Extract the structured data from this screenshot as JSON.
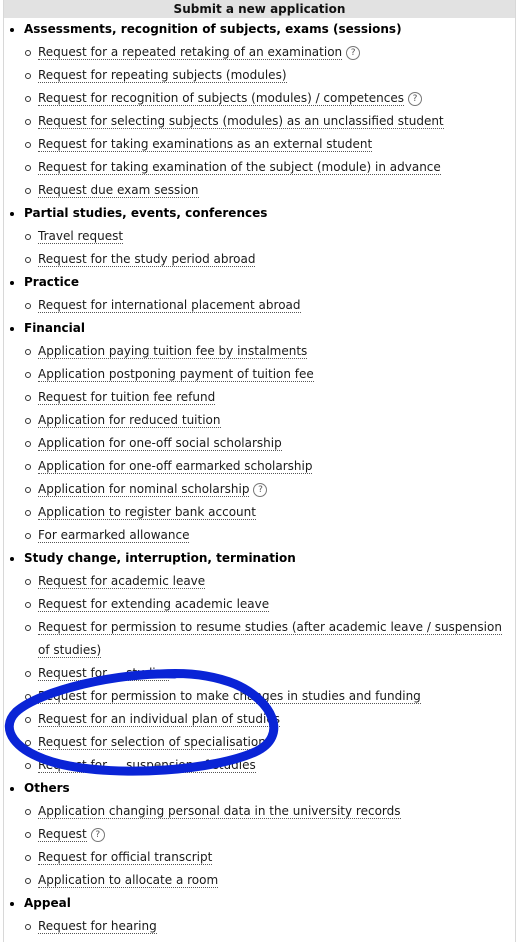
{
  "header": {
    "title": "Submit a new application"
  },
  "groups": [
    {
      "title": "Assessments, recognition of subjects, exams (sessions)",
      "items": [
        {
          "label": "Request for a repeated retaking of an examination",
          "help": true
        },
        {
          "label": "Request for repeating subjects (modules)",
          "help": false
        },
        {
          "label": "Request for recognition of subjects (modules) / competences",
          "help": true
        },
        {
          "label": "Request for selecting subjects (modules) as an unclassified student",
          "help": false
        },
        {
          "label": "Request for taking examinations as an external student",
          "help": false
        },
        {
          "label": "Request for taking examination of the subject (module) in advance",
          "help": false
        },
        {
          "label": "Request due exam session",
          "help": false
        }
      ]
    },
    {
      "title": "Partial studies, events, conferences",
      "items": [
        {
          "label": "Travel request",
          "help": false
        },
        {
          "label": "Request for the study period abroad",
          "help": false
        }
      ]
    },
    {
      "title": "Practice",
      "items": [
        {
          "label": "Request for international placement abroad",
          "help": false
        }
      ]
    },
    {
      "title": "Financial",
      "items": [
        {
          "label": "Application paying tuition fee by instalments",
          "help": false
        },
        {
          "label": "Application postponing payment of tuition fee",
          "help": false
        },
        {
          "label": "Request for tuition fee refund",
          "help": false
        },
        {
          "label": "Application for reduced tuition",
          "help": false
        },
        {
          "label": "Application for one-off social scholarship",
          "help": false
        },
        {
          "label": "Application for one-off earmarked scholarship",
          "help": false
        },
        {
          "label": "Application for nominal scholarship",
          "help": true
        },
        {
          "label": "Application to register bank account",
          "help": false
        },
        {
          "label": "For earmarked allowance",
          "help": false
        }
      ]
    },
    {
      "title": "Study change, interruption, termination",
      "items": [
        {
          "label": "Request for academic leave",
          "help": false
        },
        {
          "label": "Request for extending academic leave",
          "help": false
        },
        {
          "label": "Request for permission to resume studies (after academic leave / suspension of studies)",
          "help": false
        },
        {
          "label": "Request for ... studies",
          "help": false
        },
        {
          "label": "Request for permission to make changes in studies and funding",
          "help": false
        },
        {
          "label": "Request for an individual plan of studies",
          "help": false
        },
        {
          "label": "Request for selection of specialisation",
          "help": false
        },
        {
          "label": "Request for ... suspension of studies",
          "help": false
        }
      ]
    },
    {
      "title": "Others",
      "items": [
        {
          "label": "Application changing personal data in the university records",
          "help": false
        },
        {
          "label": "Request",
          "help": true
        },
        {
          "label": "Request for official transcript",
          "help": false
        },
        {
          "label": "Application to allocate a room",
          "help": false
        }
      ]
    },
    {
      "title": "Appeal",
      "items": [
        {
          "label": "Request for hearing",
          "help": false
        }
      ]
    }
  ],
  "help_icon_glyph": "?",
  "annotation_color": "#0a24d6"
}
